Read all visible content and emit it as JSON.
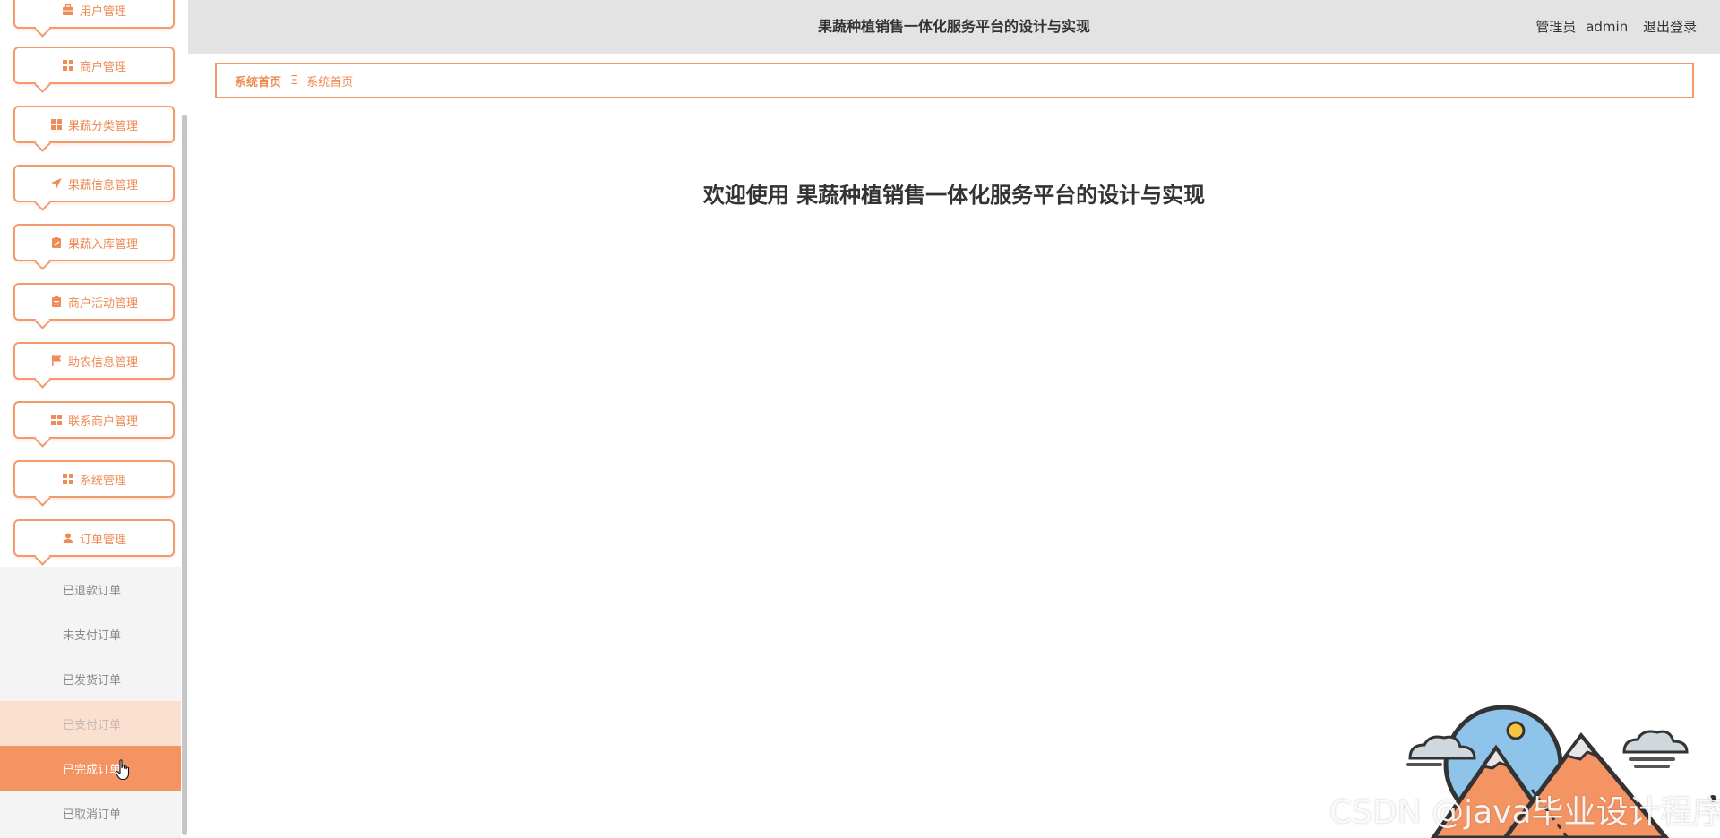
{
  "header": {
    "title": "果蔬种植销售一体化服务平台的设计与实现",
    "user_role": "管理员",
    "username": "admin",
    "logout": "退出登录"
  },
  "breadcrumb": {
    "home": "系统首页",
    "separator": "Ξ",
    "current": "系统首页"
  },
  "main": {
    "welcome": "欢迎使用 果蔬种植销售一体化服务平台的设计与实现"
  },
  "sidebar": {
    "items": [
      {
        "label": "用户管理",
        "icon": "briefcase-icon"
      },
      {
        "label": "商户管理",
        "icon": "grid-icon"
      },
      {
        "label": "果蔬分类管理",
        "icon": "grid-icon"
      },
      {
        "label": "果蔬信息管理",
        "icon": "paper-plane-icon"
      },
      {
        "label": "果蔬入库管理",
        "icon": "clipboard-check-icon"
      },
      {
        "label": "商户活动管理",
        "icon": "clipboard-icon"
      },
      {
        "label": "助农信息管理",
        "icon": "flag-icon"
      },
      {
        "label": "联系商户管理",
        "icon": "grid-icon"
      },
      {
        "label": "系统管理",
        "icon": "grid-icon"
      },
      {
        "label": "订单管理",
        "icon": "user-icon"
      }
    ],
    "order_submenu": [
      "已退款订单",
      "未支付订单",
      "已发货订单",
      "已支付订单",
      "已完成订单",
      "已取消订单"
    ]
  },
  "watermark": "CSDN @java毕业设计程序",
  "colors": {
    "accent": "#f29a6c",
    "accent_text": "#ef8c56",
    "active_bg": "#f59463",
    "header_bg": "#e3e3e3"
  }
}
